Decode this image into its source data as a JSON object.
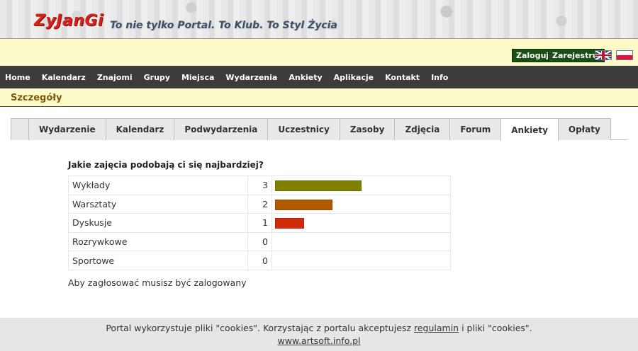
{
  "header": {
    "logo_text": "ZyJanGi",
    "slogan": "To nie tylko Portal. To Klub. To Styl Życia"
  },
  "auth": {
    "login_label": "Zaloguj",
    "register_label": "Zarejestruj"
  },
  "nav": {
    "items": [
      "Home",
      "Kalendarz",
      "Znajomi",
      "Grupy",
      "Miejsca",
      "Wydarzenia",
      "Ankiety",
      "Aplikacje",
      "Kontakt",
      "Info"
    ]
  },
  "section": {
    "title": "Szczegóły"
  },
  "tabs": {
    "items": [
      "Wydarzenie",
      "Kalendarz",
      "Podwydarzenia",
      "Uczestnicy",
      "Zasoby",
      "Zdjęcia",
      "Forum",
      "Ankiety",
      "Opłaty"
    ],
    "active": "Ankiety"
  },
  "poll": {
    "question": "Jakie zajęcia podobają ci się najbardziej?",
    "max_votes": 3,
    "options": [
      {
        "label": "Wykłady",
        "votes": 3,
        "color": "#808000"
      },
      {
        "label": "Warsztaty",
        "votes": 2,
        "color": "#b05a00"
      },
      {
        "label": "Dyskusje",
        "votes": 1,
        "color": "#d12a0a"
      },
      {
        "label": "Rozrywkowe",
        "votes": 0,
        "color": ""
      },
      {
        "label": "Sportowe",
        "votes": 0,
        "color": ""
      }
    ],
    "note": "Aby zagłosować musisz być zalogowany"
  },
  "cookies": {
    "text_before": "Portal wykorzystuje pliki \"cookies\". Korzystając z portalu akceptujesz",
    "link_label": "regulamin",
    "text_after": "i pliki \"cookies\".",
    "site_link": "www.artsoft.info.pl"
  }
}
